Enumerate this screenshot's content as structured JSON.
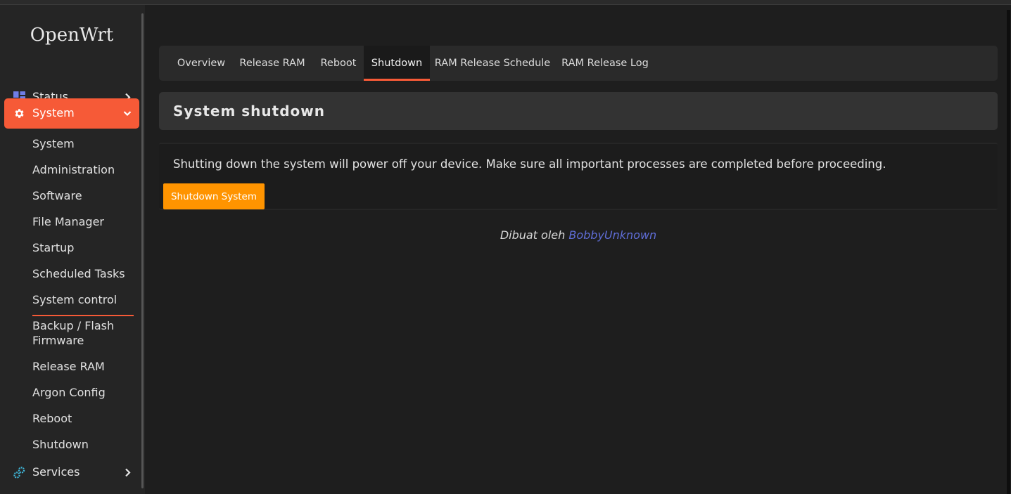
{
  "brand": "OpenWrt",
  "sidebar": {
    "status_label": "Status",
    "system_label": "System",
    "services_label": "Services",
    "submenu": [
      "System",
      "Administration",
      "Software",
      "File Manager",
      "Startup",
      "Scheduled Tasks",
      "System control",
      "Backup / Flash Firmware",
      "Release RAM",
      "Argon Config",
      "Reboot",
      "Shutdown"
    ],
    "active_submenu": "System control",
    "accent_color": "#f65a37"
  },
  "tabs": [
    "Overview",
    "Release RAM",
    "Reboot",
    "Shutdown",
    "RAM Release Schedule",
    "RAM Release Log"
  ],
  "active_tab": "Shutdown",
  "section": {
    "title": "System shutdown",
    "description": "Shutting down the system will power off your device. Make sure all important processes are completed before proceeding.",
    "button_label": "Shutdown System",
    "button_color": "#ff9400"
  },
  "footer": {
    "prefix": "Dibuat oleh",
    "link_text": "BobbyUnknown",
    "link_color": "#5f6dd6"
  }
}
